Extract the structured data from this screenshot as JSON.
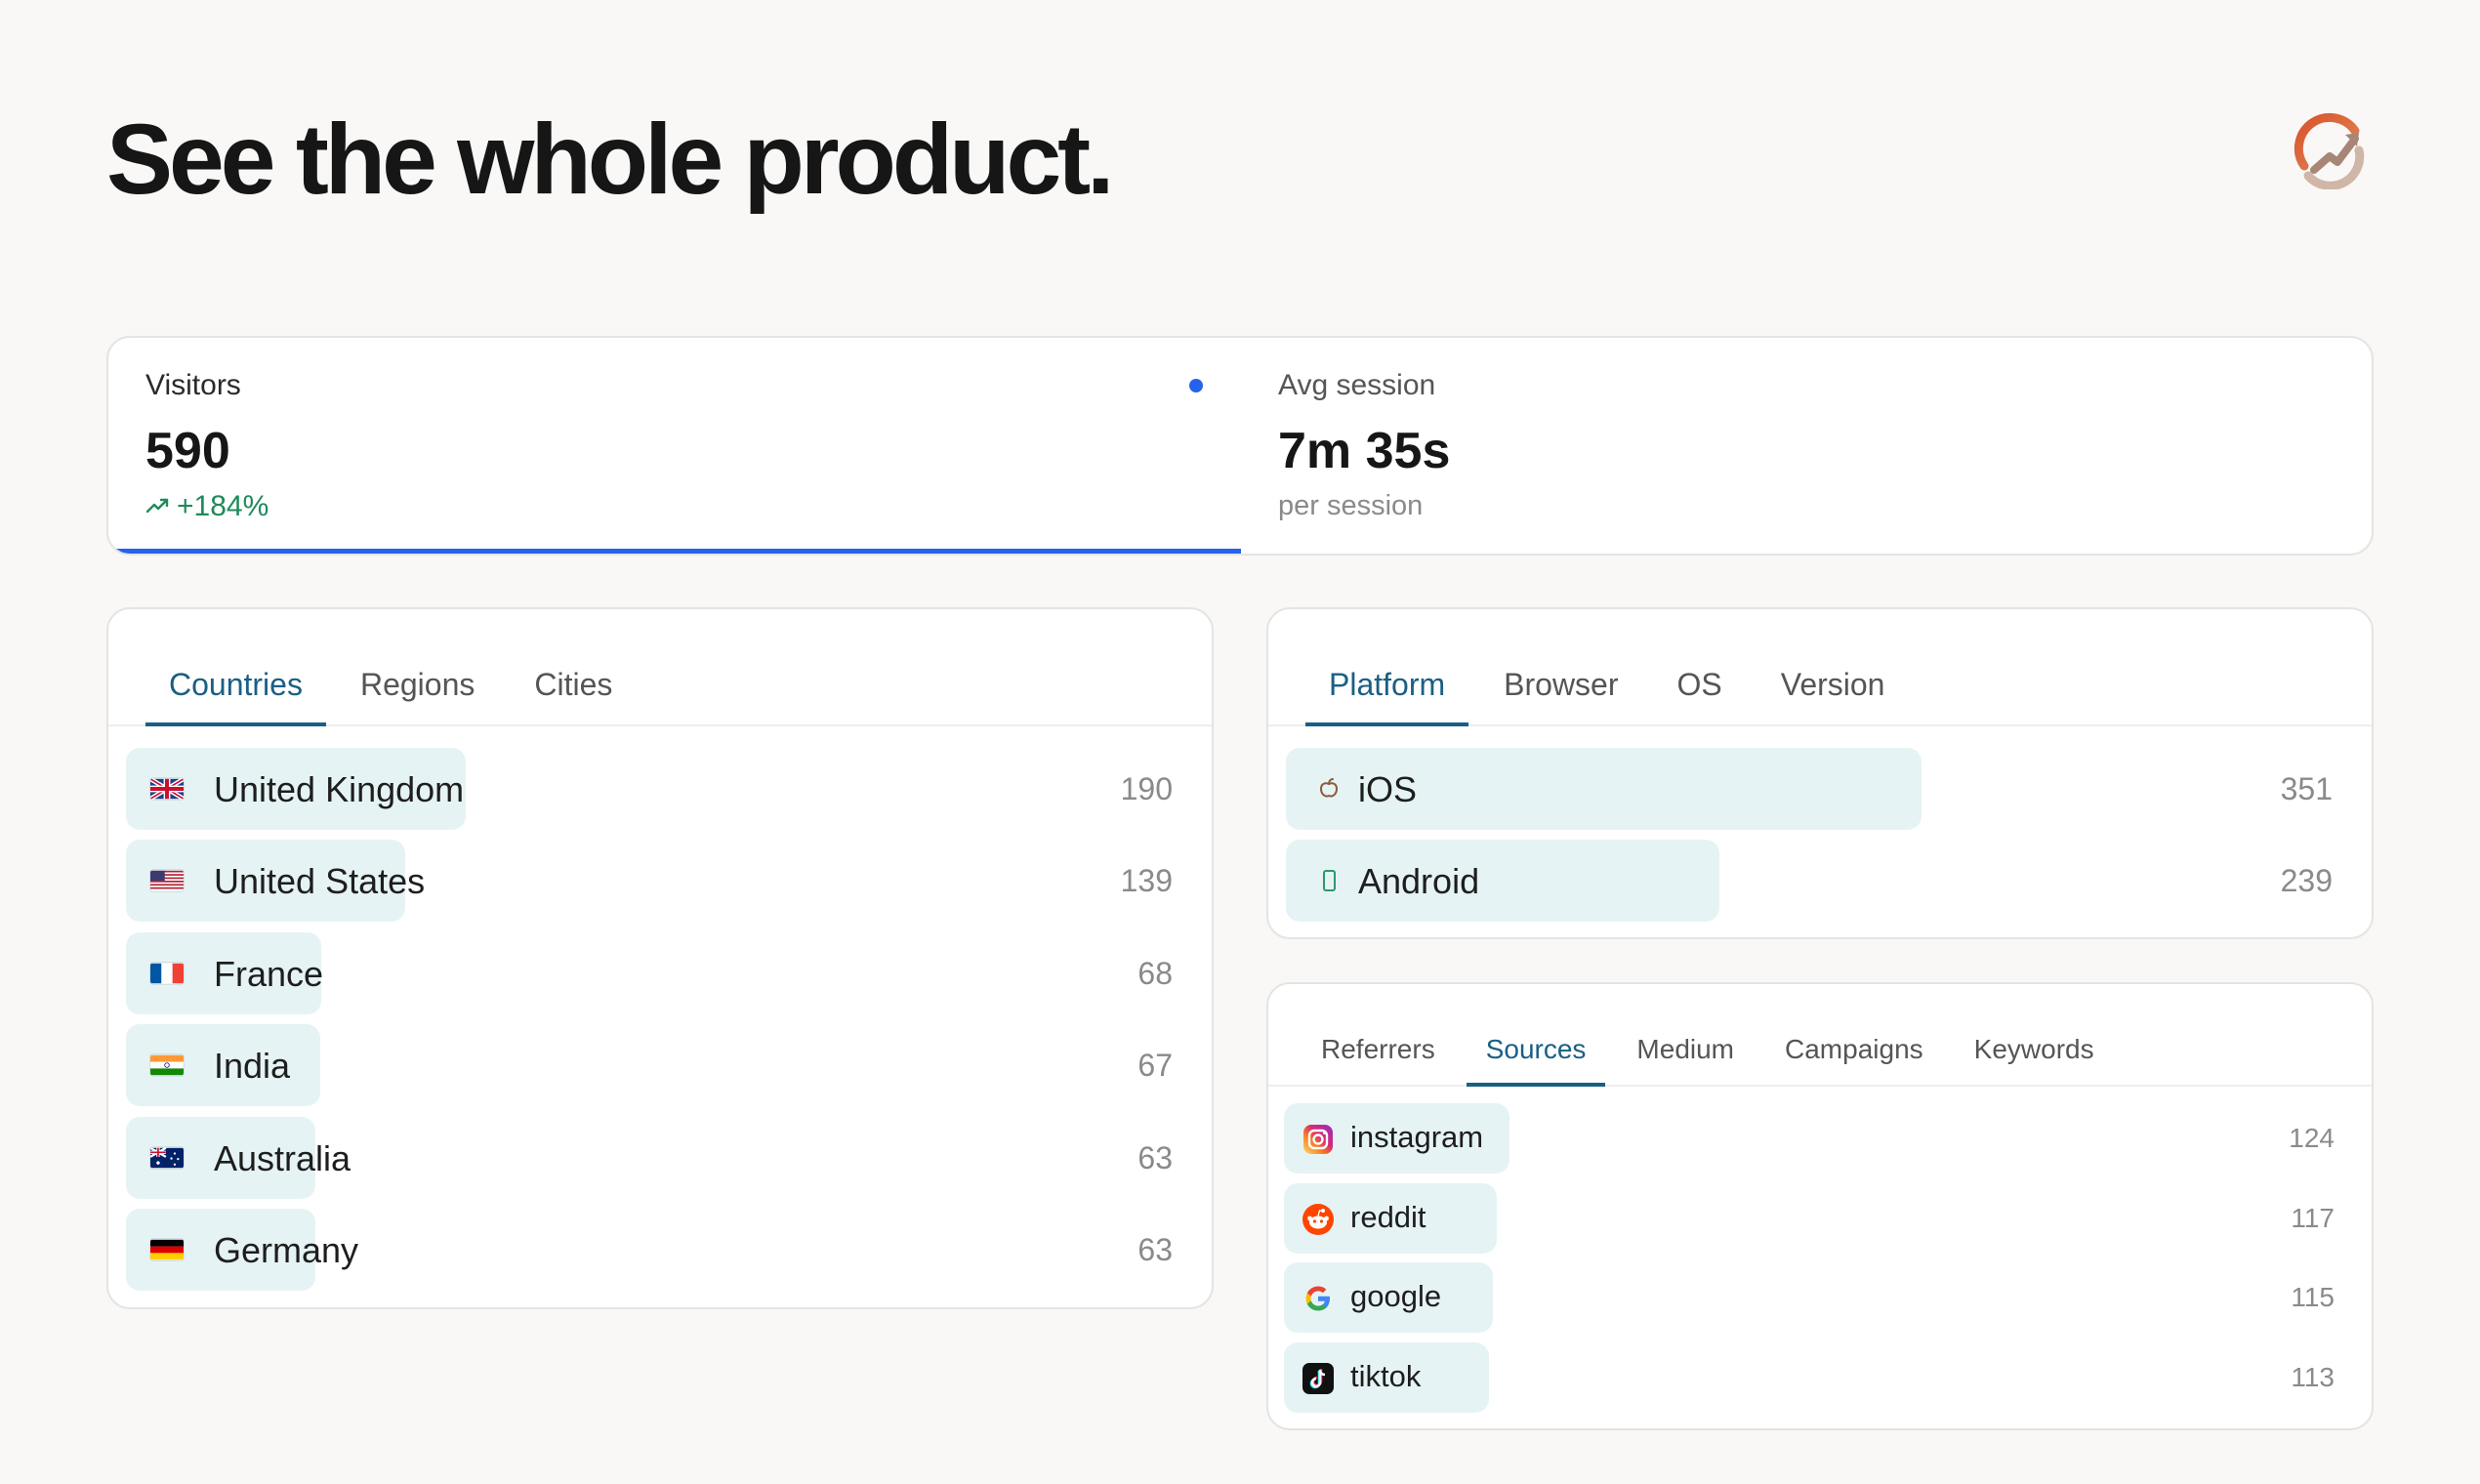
{
  "headline": "See the whole product.",
  "logo_icon": "rising-chart-circle-icon",
  "stats": {
    "visitors": {
      "label": "Visitors",
      "value": "590",
      "delta": "+184%",
      "delta_icon": "trending-up-icon"
    },
    "avg_session": {
      "label": "Avg session",
      "value": "7m 35s",
      "sub": "per session"
    }
  },
  "countries": {
    "tabs": [
      "Countries",
      "Regions",
      "Cities"
    ],
    "active_tab": "Countries",
    "max": 190,
    "rows": [
      {
        "label": "United Kingdom",
        "count": "190",
        "value": 190,
        "icon": "uk-flag-icon"
      },
      {
        "label": "United States",
        "count": "139",
        "value": 139,
        "icon": "us-flag-icon"
      },
      {
        "label": "France",
        "count": "68",
        "value": 68,
        "icon": "france-flag-icon"
      },
      {
        "label": "India",
        "count": "67",
        "value": 67,
        "icon": "india-flag-icon"
      },
      {
        "label": "Australia",
        "count": "63",
        "value": 63,
        "icon": "australia-flag-icon"
      },
      {
        "label": "Germany",
        "count": "63",
        "value": 63,
        "icon": "germany-flag-icon"
      }
    ]
  },
  "platform": {
    "tabs": [
      "Platform",
      "Browser",
      "OS",
      "Version"
    ],
    "active_tab": "Platform",
    "max": 590,
    "rows": [
      {
        "label": "iOS",
        "count": "351",
        "value": 351,
        "icon": "apple-icon"
      },
      {
        "label": "Android",
        "count": "239",
        "value": 239,
        "icon": "phone-icon"
      }
    ]
  },
  "sources": {
    "tabs": [
      "Referrers",
      "Sources",
      "Medium",
      "Campaigns",
      "Keywords"
    ],
    "active_tab": "Sources",
    "max": 590,
    "rows": [
      {
        "label": "instagram",
        "count": "124",
        "value": 124,
        "icon": "instagram-icon"
      },
      {
        "label": "reddit",
        "count": "117",
        "value": 117,
        "icon": "reddit-icon"
      },
      {
        "label": "google",
        "count": "115",
        "value": 115,
        "icon": "google-icon"
      },
      {
        "label": "tiktok",
        "count": "113",
        "value": 113,
        "icon": "tiktok-icon"
      }
    ]
  },
  "colors": {
    "accent_blue": "#2563eb",
    "tab_active": "#1a5f84",
    "bar_fill": "#e6f3f4",
    "positive_green": "#1f8a5a"
  }
}
